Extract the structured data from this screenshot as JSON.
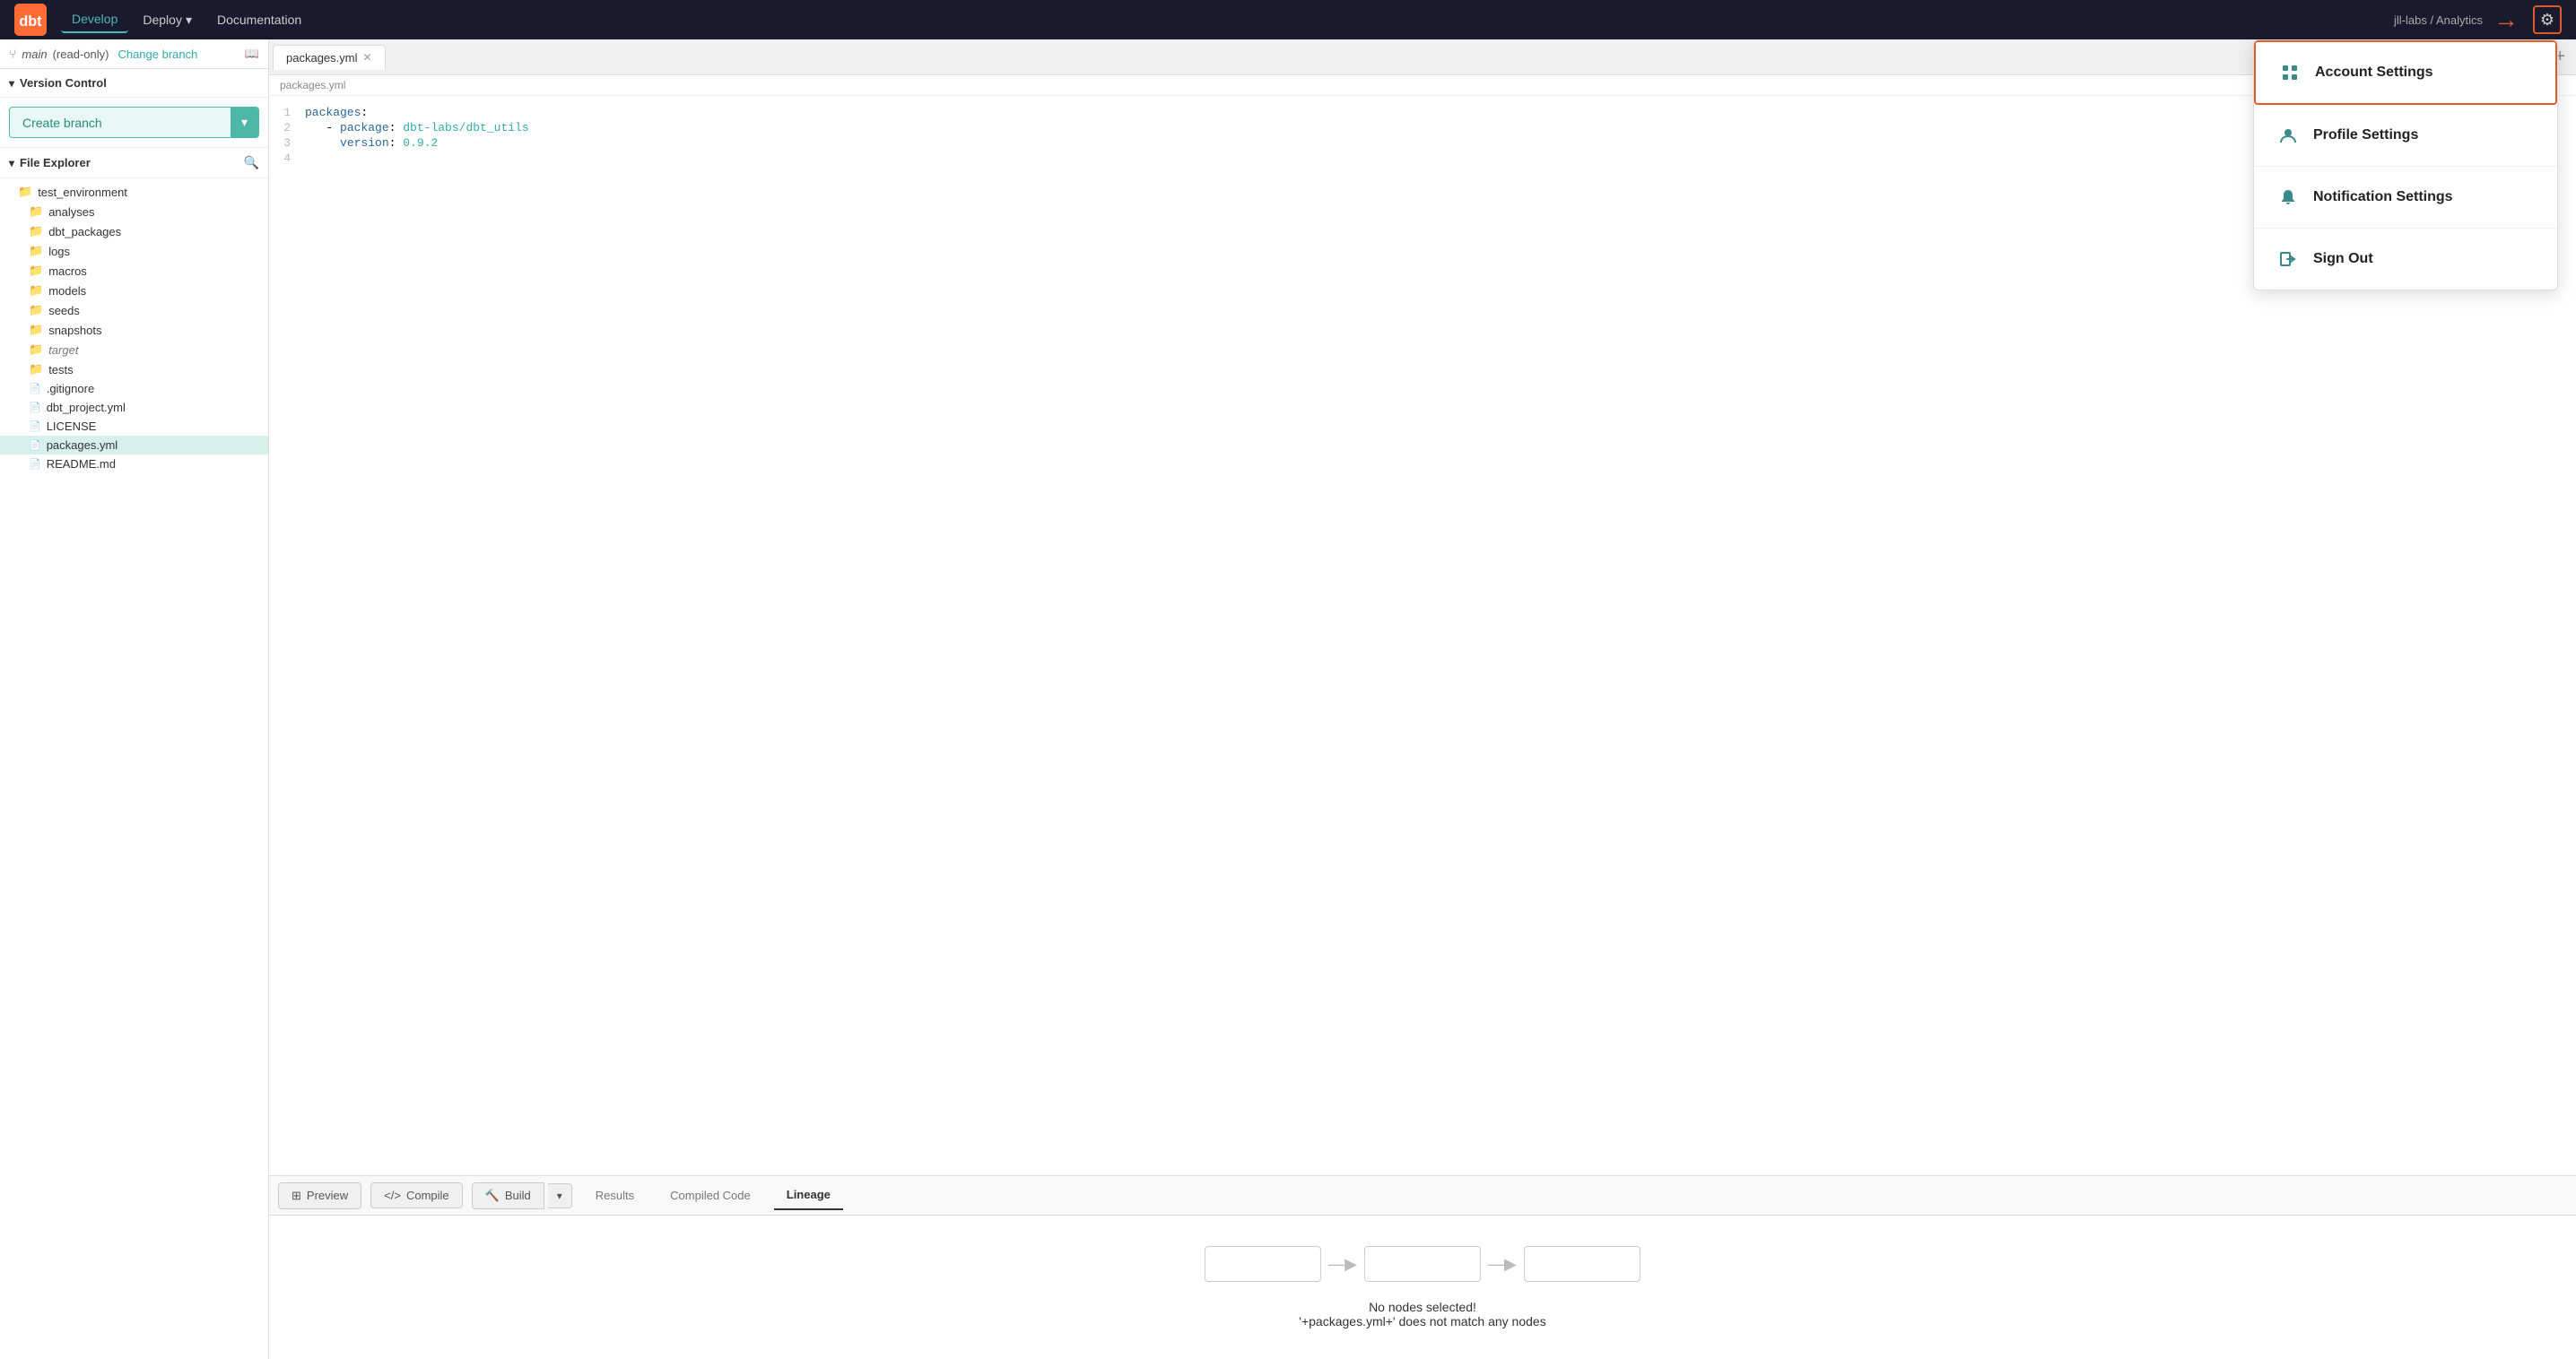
{
  "nav": {
    "logo_alt": "dbt logo",
    "items": [
      {
        "label": "Develop",
        "active": true
      },
      {
        "label": "Deploy",
        "active": false,
        "has_chevron": true
      },
      {
        "label": "Documentation",
        "active": false
      }
    ],
    "project_label": "jll-labs / Analytics",
    "gear_label": "Settings"
  },
  "sidebar": {
    "branch": {
      "name": "main",
      "suffix": "(read-only)",
      "change_link": "Change branch"
    },
    "version_control": {
      "header": "Version Control"
    },
    "create_branch": {
      "label": "Create branch"
    },
    "file_explorer": {
      "header": "File Explorer",
      "root": "test_environment",
      "items": [
        {
          "name": "analyses",
          "type": "folder",
          "indent": 1
        },
        {
          "name": "dbt_packages",
          "type": "folder",
          "indent": 1
        },
        {
          "name": "logs",
          "type": "folder",
          "indent": 1
        },
        {
          "name": "macros",
          "type": "folder",
          "indent": 1
        },
        {
          "name": "models",
          "type": "folder",
          "indent": 1
        },
        {
          "name": "seeds",
          "type": "folder",
          "indent": 1
        },
        {
          "name": "snapshots",
          "type": "folder",
          "indent": 1
        },
        {
          "name": "target",
          "type": "folder",
          "indent": 1,
          "italic": true
        },
        {
          "name": "tests",
          "type": "folder",
          "indent": 1
        },
        {
          "name": ".gitignore",
          "type": "file",
          "indent": 1
        },
        {
          "name": "dbt_project.yml",
          "type": "file",
          "indent": 1
        },
        {
          "name": "LICENSE",
          "type": "file",
          "indent": 1
        },
        {
          "name": "packages.yml",
          "type": "file-yml",
          "indent": 1,
          "active": true
        },
        {
          "name": "README.md",
          "type": "file",
          "indent": 1
        }
      ]
    }
  },
  "editor": {
    "tab_name": "packages.yml",
    "breadcrumb": "packages.yml",
    "lines": [
      {
        "num": "1",
        "content": "packages:",
        "type": "key"
      },
      {
        "num": "2",
        "content": "  - package: dbt-labs/dbt_utils",
        "type": "mixed"
      },
      {
        "num": "3",
        "content": "    version: 0.9.2",
        "type": "mixed"
      },
      {
        "num": "4",
        "content": "",
        "type": "empty"
      }
    ]
  },
  "bottom_panel": {
    "actions": [
      {
        "label": "Preview",
        "icon": "table"
      },
      {
        "label": "Compile",
        "icon": "code"
      },
      {
        "label": "Build",
        "icon": "hammer"
      }
    ],
    "tabs": [
      {
        "label": "Results"
      },
      {
        "label": "Compiled Code"
      },
      {
        "label": "Lineage",
        "active": true
      }
    ],
    "lineage": {
      "message": "No nodes selected!",
      "sub_message": "'+packages.yml+' does not match any nodes"
    }
  },
  "dropdown": {
    "items": [
      {
        "label": "Account Settings",
        "icon": "grid",
        "active": true
      },
      {
        "label": "Profile Settings",
        "icon": "user"
      },
      {
        "label": "Notification Settings",
        "icon": "bell"
      },
      {
        "label": "Sign Out",
        "icon": "sign-out"
      }
    ]
  }
}
